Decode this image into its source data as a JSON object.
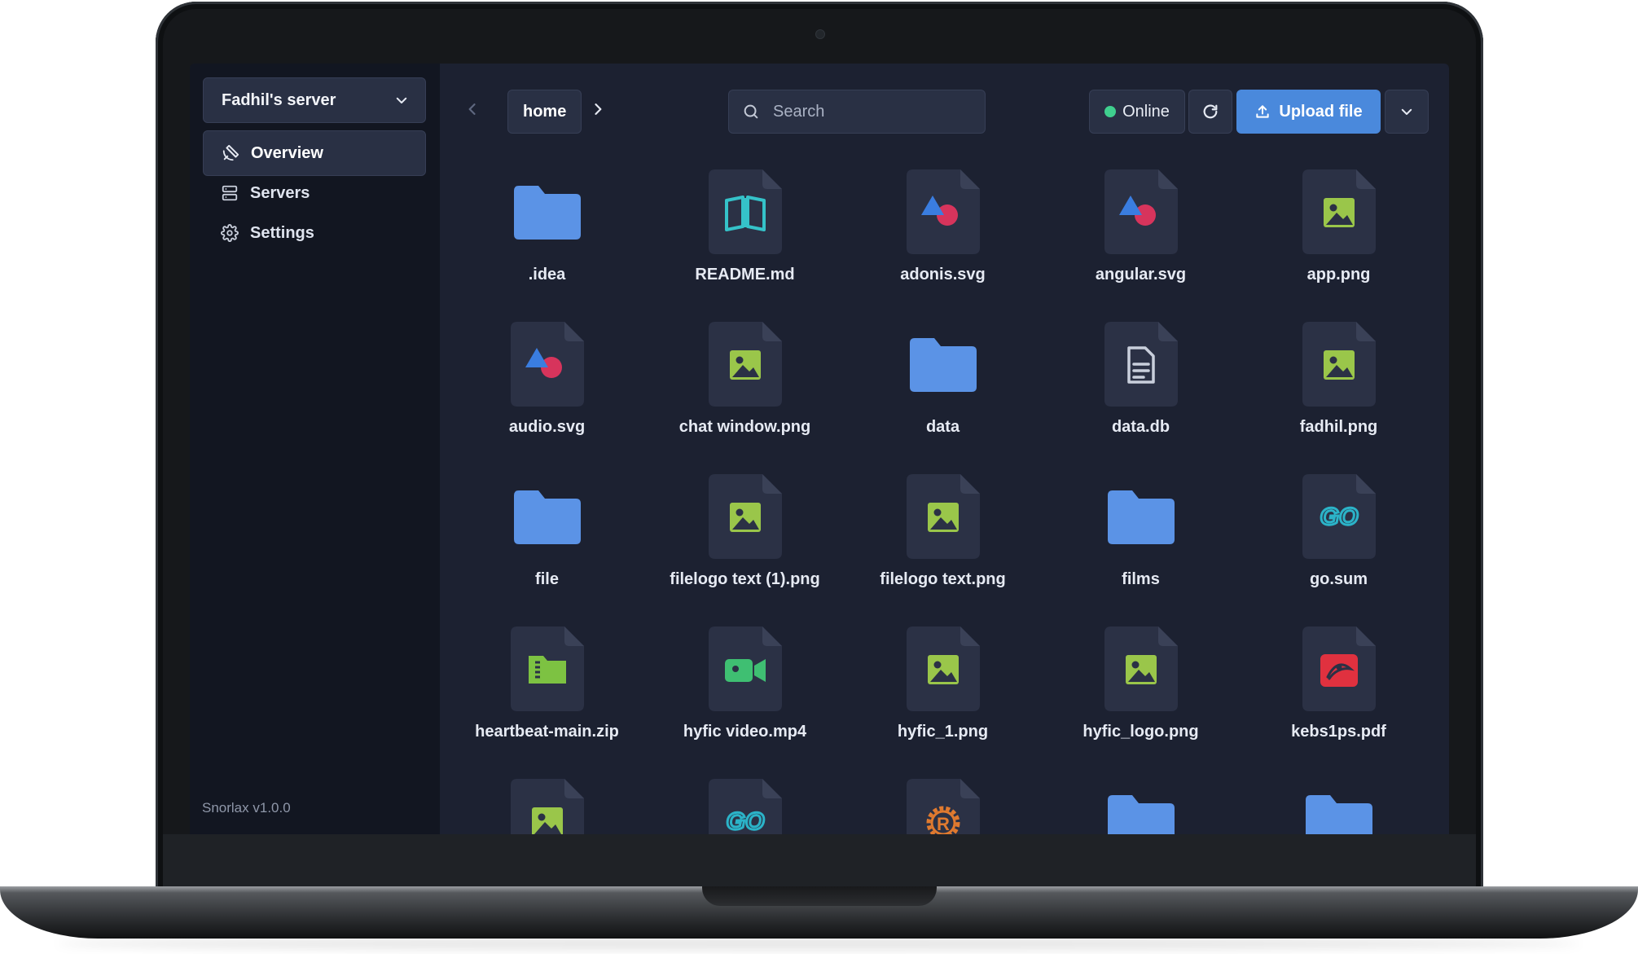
{
  "app": {
    "server_name": "Fadhil's server",
    "version": "Snorlax v1.0.0"
  },
  "sidebar": {
    "items": [
      {
        "label": "Overview",
        "icon": "satellite-icon",
        "active": true
      },
      {
        "label": "Servers",
        "icon": "server-icon",
        "active": false
      },
      {
        "label": "Settings",
        "icon": "gear-icon",
        "active": false
      }
    ]
  },
  "toolbar": {
    "breadcrumb": "home",
    "search_placeholder": "Search",
    "status_label": "Online",
    "upload_label": "Upload file"
  },
  "colors": {
    "accent": "#4a89dc",
    "online": "#3fcf8e",
    "folder": "#5b93e6",
    "image": "#9ac64a",
    "archive": "#7dc242",
    "video": "#3fbf72",
    "pdf": "#e0313f",
    "go": "#2bb3c8",
    "rust": "#e07a2f"
  },
  "files": [
    {
      "name": ".idea",
      "type": "folder-icon"
    },
    {
      "name": "README.md",
      "type": "book-icon"
    },
    {
      "name": "adonis.svg",
      "type": "vector-icon"
    },
    {
      "name": "angular.svg",
      "type": "vector-icon"
    },
    {
      "name": "app.png",
      "type": "image-icon"
    },
    {
      "name": "audio.svg",
      "type": "vector-icon"
    },
    {
      "name": "chat window.png",
      "type": "image-icon"
    },
    {
      "name": "data",
      "type": "folder-icon"
    },
    {
      "name": "data.db",
      "type": "document-icon"
    },
    {
      "name": "fadhil.png",
      "type": "image-icon"
    },
    {
      "name": "file",
      "type": "folder-icon"
    },
    {
      "name": "filelogo text (1).png",
      "type": "image-icon"
    },
    {
      "name": "filelogo text.png",
      "type": "image-icon"
    },
    {
      "name": "films",
      "type": "folder-icon"
    },
    {
      "name": "go.sum",
      "type": "go-icon"
    },
    {
      "name": "heartbeat-main.zip",
      "type": "archive-icon"
    },
    {
      "name": "hyfic video.mp4",
      "type": "video-icon"
    },
    {
      "name": "hyfic_1.png",
      "type": "image-icon"
    },
    {
      "name": "hyfic_logo.png",
      "type": "image-icon"
    },
    {
      "name": "kebs1ps.pdf",
      "type": "pdf-icon"
    },
    {
      "name": "",
      "type": "image-icon"
    },
    {
      "name": "",
      "type": "go-icon"
    },
    {
      "name": "",
      "type": "rust-icon"
    },
    {
      "name": "",
      "type": "folder-icon"
    },
    {
      "name": "",
      "type": "folder-icon"
    }
  ]
}
